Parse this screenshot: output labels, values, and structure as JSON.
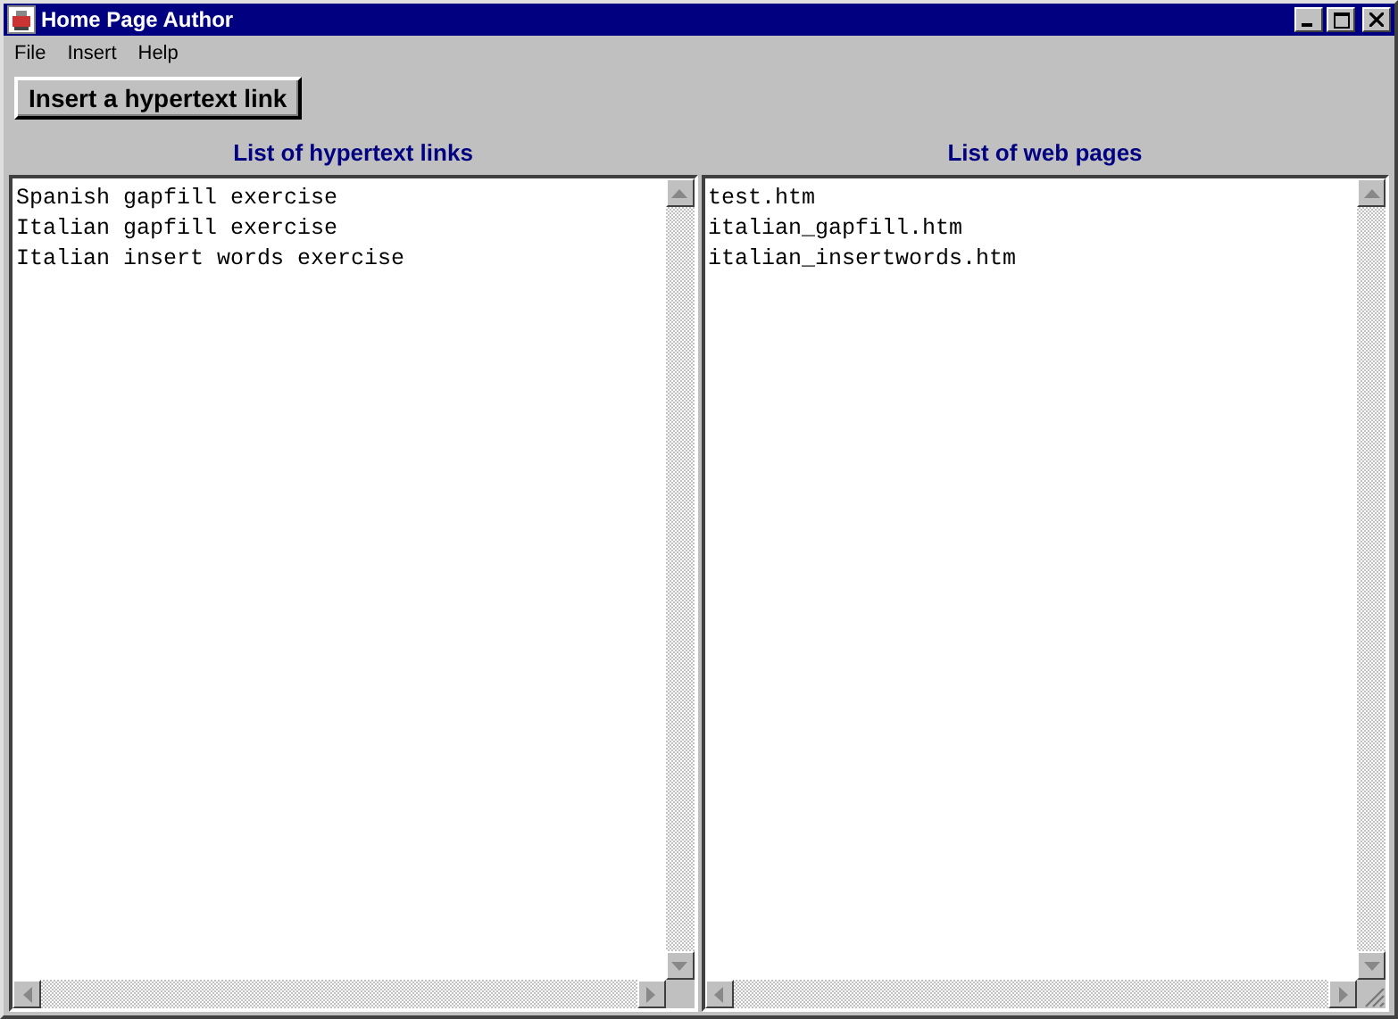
{
  "window": {
    "title": "Home Page Author"
  },
  "menu": [
    "File",
    "Insert",
    "Help"
  ],
  "toolbar": {
    "button": "Insert a hypertext link"
  },
  "panels": [
    {
      "heading": "List of hypertext links",
      "items": [
        "Spanish gapfill exercise",
        "Italian gapfill exercise",
        "Italian insert words exercise"
      ]
    },
    {
      "heading": "List of web pages",
      "items": [
        "test.htm",
        "italian_gapfill.htm",
        "italian_insertwords.htm"
      ]
    }
  ]
}
